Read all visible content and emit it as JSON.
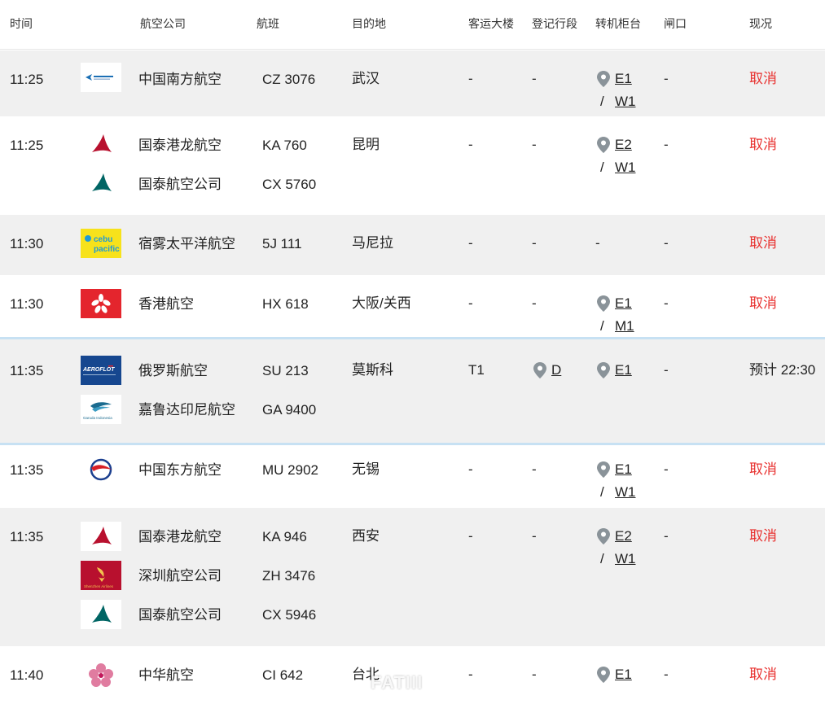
{
  "header": {
    "time": "时间",
    "airline": "航空公司",
    "flight": "航班",
    "destination": "目的地",
    "terminal": "客运大楼",
    "checkin": "登记行段",
    "transfer": "转机柜台",
    "gate": "闸口",
    "status": "现况"
  },
  "rows": [
    {
      "time": "11:25",
      "flights": [
        {
          "airline": "中国南方航空",
          "flight": "CZ 3076",
          "logo": "china-southern-logo"
        }
      ],
      "destination": "武汉",
      "terminal": "-",
      "checkin": "-",
      "transfer_a": "E1",
      "transfer_b": "W1",
      "gate": "-",
      "status": "取消"
    },
    {
      "time": "11:25",
      "flights": [
        {
          "airline": "国泰港龙航空",
          "flight": "KA 760",
          "logo": "cathay-dragon-logo"
        },
        {
          "airline": "国泰航空公司",
          "flight": "CX 5760",
          "logo": "cathay-pacific-logo"
        }
      ],
      "destination": "昆明",
      "terminal": "-",
      "checkin": "-",
      "transfer_a": "E2",
      "transfer_b": "W1",
      "gate": "-",
      "status": "取消"
    },
    {
      "time": "11:30",
      "flights": [
        {
          "airline": "宿雾太平洋航空",
          "flight": "5J 111",
          "logo": "cebu-pacific-logo",
          "logo_text_a": "cebu",
          "logo_text_b": "pacific"
        }
      ],
      "destination": "马尼拉",
      "terminal": "-",
      "checkin": "-",
      "transfer": "-",
      "gate": "-",
      "status": "取消"
    },
    {
      "time": "11:30",
      "flights": [
        {
          "airline": "香港航空",
          "flight": "HX 618",
          "logo": "hong-kong-airlines-logo"
        }
      ],
      "destination": "大阪/关西",
      "terminal": "-",
      "checkin": "-",
      "transfer_a": "E1",
      "transfer_b": "M1",
      "gate": "-",
      "status": "取消"
    },
    {
      "time": "11:35",
      "flights": [
        {
          "airline": "俄罗斯航空",
          "flight": "SU 213",
          "logo": "aeroflot-logo",
          "logo_text": "AEROFLOT"
        },
        {
          "airline": "嘉鲁达印尼航空",
          "flight": "GA 9400",
          "logo": "garuda-indonesia-logo",
          "logo_text": "Garuda Indonesia"
        }
      ],
      "destination": "莫斯科",
      "terminal": "T1",
      "checkin": "D",
      "transfer": "E1",
      "gate": "-",
      "status": "预计 22:30"
    },
    {
      "time": "11:35",
      "flights": [
        {
          "airline": "中国东方航空",
          "flight": "MU 2902",
          "logo": "china-eastern-logo"
        }
      ],
      "destination": "无锡",
      "terminal": "-",
      "checkin": "-",
      "transfer_a": "E1",
      "transfer_b": "W1",
      "gate": "-",
      "status": "取消"
    },
    {
      "time": "11:35",
      "flights": [
        {
          "airline": "国泰港龙航空",
          "flight": "KA 946",
          "logo": "cathay-dragon-logo"
        },
        {
          "airline": "深圳航空公司",
          "flight": "ZH 3476",
          "logo": "shenzhen-airlines-logo",
          "logo_text": "Shenzhen Airlines"
        },
        {
          "airline": "国泰航空公司",
          "flight": "CX 5946",
          "logo": "cathay-pacific-logo"
        }
      ],
      "destination": "西安",
      "terminal": "-",
      "checkin": "-",
      "transfer_a": "E2",
      "transfer_b": "W1",
      "gate": "-",
      "status": "取消"
    },
    {
      "time": "11:40",
      "flights": [
        {
          "airline": "中华航空",
          "flight": "CI 642",
          "logo": "china-airlines-logo"
        }
      ],
      "destination": "台北",
      "terminal": "-",
      "checkin": "-",
      "transfer": "E1",
      "gate": "-",
      "status": "取消"
    }
  ],
  "watermark": "FATIII",
  "colors": {
    "cancel": "#e8312f",
    "alt_row": "#f0f0f0",
    "highlight_border": "#c7e1f3",
    "pin": "#8a9399"
  }
}
